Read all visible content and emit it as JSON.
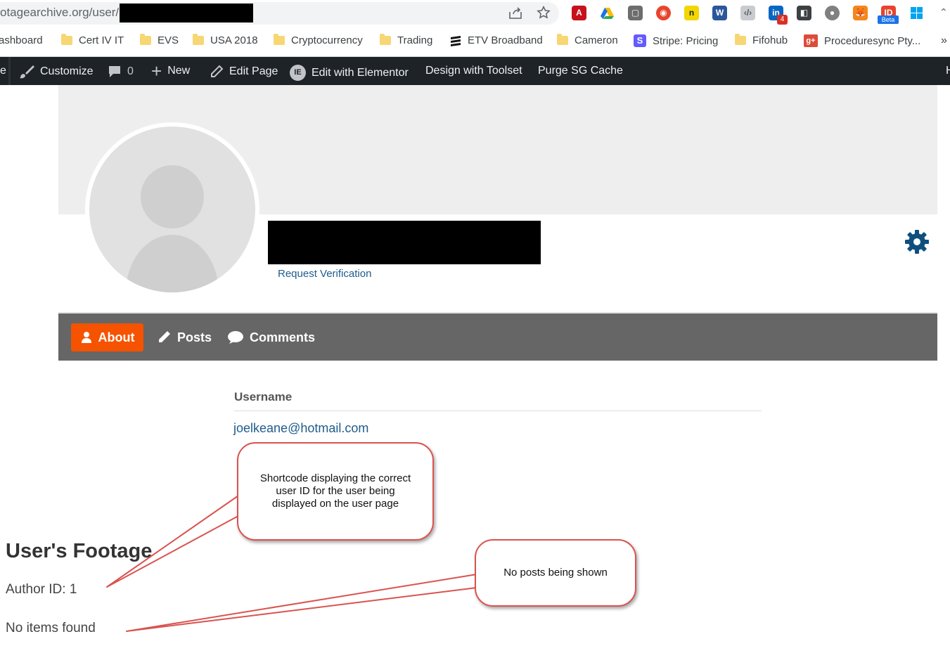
{
  "browser": {
    "url": "otagearchive.org/user/",
    "bookmarks": [
      "ashboard",
      "Cert IV IT",
      "EVS",
      "USA 2018",
      "Cryptocurrency",
      "Trading",
      "ETV Broadband",
      "Cameron",
      "Stripe: Pricing",
      "Fifohub",
      "Proceduresync Pty..."
    ],
    "more": "»",
    "linkedin_badge": "4",
    "beta_badge": "Beta"
  },
  "admin_bar": {
    "site_stub": "e",
    "customize": "Customize",
    "comments_count": "0",
    "new": "New",
    "edit_page": "Edit Page",
    "edit_elementor": "Edit with Elementor",
    "toolset": "Design with Toolset",
    "purge": "Purge SG Cache",
    "right_stub": "H"
  },
  "profile": {
    "request_verification": "Request Verification"
  },
  "tabs": {
    "about": "About",
    "posts": "Posts",
    "comments": "Comments"
  },
  "about": {
    "field_label": "Username",
    "field_value": "joelkeane@hotmail.com"
  },
  "footage": {
    "heading": "User's Footage",
    "author_id": "Author ID: 1",
    "no_items": "No items found"
  },
  "callouts": {
    "first": "Shortcode displaying the correct user ID for the user being displayed on the user page",
    "second": "No posts being shown"
  },
  "colors": {
    "accent_tab": "#f55300",
    "link": "#215c8b",
    "tab_bar": "#666666",
    "callout_border": "#d9534f"
  }
}
